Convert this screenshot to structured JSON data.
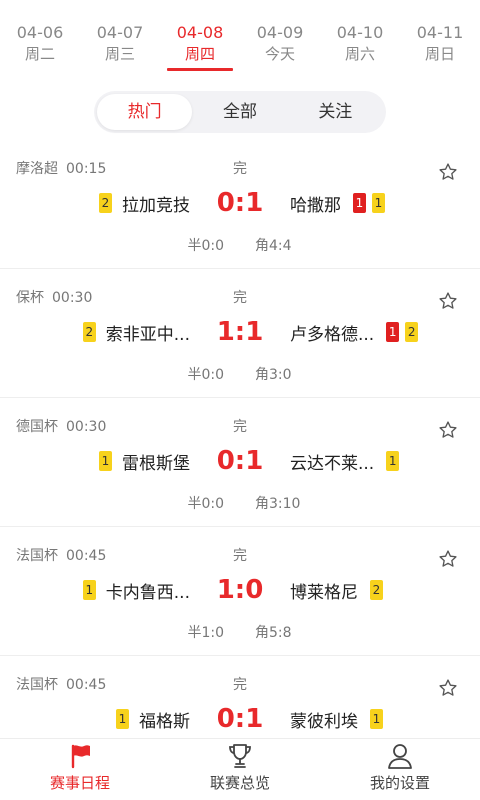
{
  "dates": [
    {
      "date": "04-06",
      "weekday": "周二"
    },
    {
      "date": "04-07",
      "weekday": "周三"
    },
    {
      "date": "04-08",
      "weekday": "周四"
    },
    {
      "date": "04-09",
      "weekday": "今天"
    },
    {
      "date": "04-10",
      "weekday": "周六"
    },
    {
      "date": "04-11",
      "weekday": "周日"
    }
  ],
  "tabs": [
    "热门",
    "全部",
    "关注"
  ],
  "matches": [
    {
      "league": "摩洛超",
      "time": "00:15",
      "status": "完",
      "home": "拉加竞技",
      "away": "哈撒那",
      "score": "0:1",
      "half": "半0:0",
      "corner": "角4:4",
      "home_yellow": "2",
      "away_red": "1",
      "away_yellow": "1"
    },
    {
      "league": "保杯",
      "time": "00:30",
      "status": "完",
      "home": "索非亚中...",
      "away": "卢多格德...",
      "score": "1:1",
      "half": "半0:0",
      "corner": "角3:0",
      "home_yellow": "2",
      "away_red": "1",
      "away_yellow": "2"
    },
    {
      "league": "德国杯",
      "time": "00:30",
      "status": "完",
      "home": "雷根斯堡",
      "away": "云达不莱...",
      "score": "0:1",
      "half": "半0:0",
      "corner": "角3:10",
      "home_yellow": "1",
      "away_yellow": "1"
    },
    {
      "league": "法国杯",
      "time": "00:45",
      "status": "完",
      "home": "卡内鲁西...",
      "away": "博莱格尼",
      "score": "1:0",
      "half": "半1:0",
      "corner": "角5:8",
      "home_yellow": "1",
      "away_yellow": "2"
    },
    {
      "league": "法国杯",
      "time": "00:45",
      "status": "完",
      "home": "福格斯",
      "away": "蒙彼利埃",
      "score": "0:1",
      "home_yellow": "1",
      "away_yellow": "1"
    }
  ],
  "nav": [
    {
      "label": "赛事日程",
      "icon": "flag-icon"
    },
    {
      "label": "联赛总览",
      "icon": "trophy-icon"
    },
    {
      "label": "我的设置",
      "icon": "user-icon"
    }
  ],
  "colors": {
    "accent": "#e8292b",
    "yellow_card": "#f7d21c",
    "red_card": "#e02020"
  }
}
